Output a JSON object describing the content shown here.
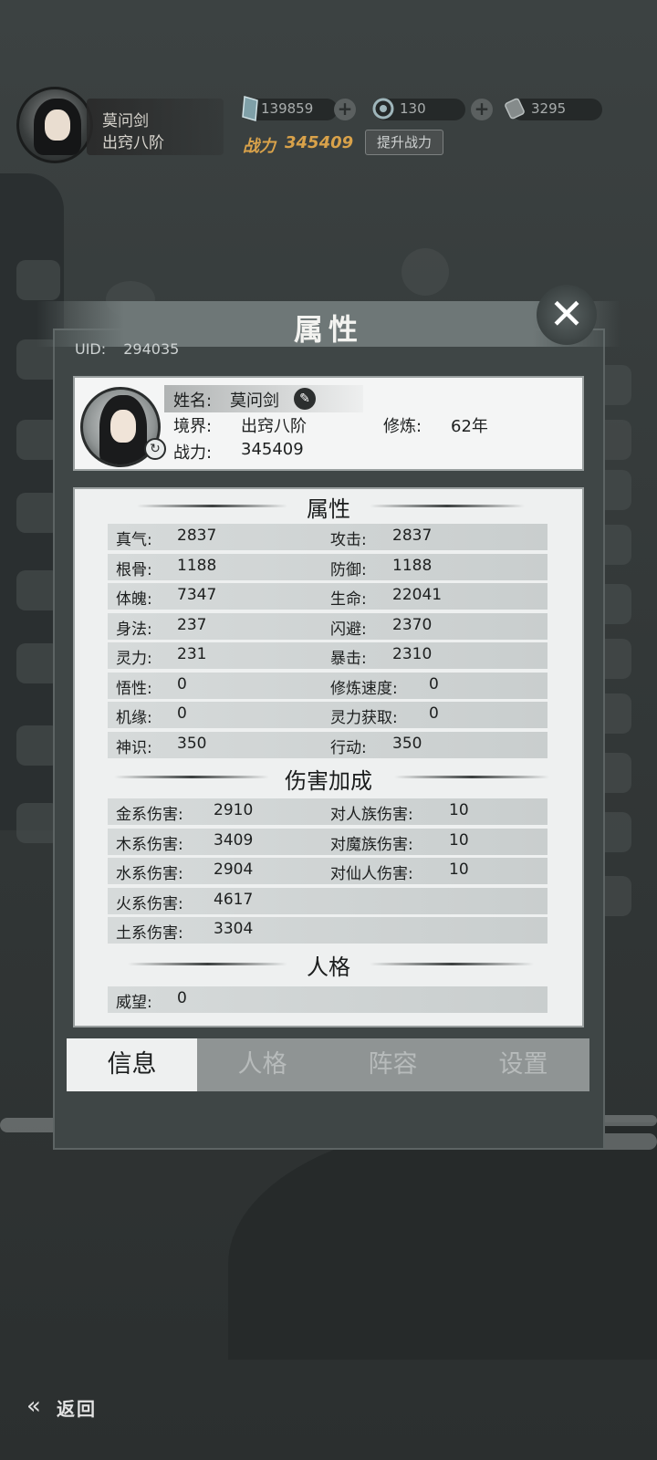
{
  "hud": {
    "player_name": "莫问剑",
    "player_realm": "出窍八阶",
    "spirit_stones": "139859",
    "jade": "130",
    "scrolls": "3295",
    "power_label": "战力",
    "power_value": "345409",
    "boost_label": "提升战力"
  },
  "dialog": {
    "title": "属性",
    "uid_label": "UID:",
    "uid_value": "294035",
    "profile": {
      "name_label": "姓名:",
      "name_value": "莫问剑",
      "realm_label": "境界:",
      "realm_value": "出窍八阶",
      "cultivation_label": "修炼:",
      "cultivation_value": "62年",
      "power_label": "战力:",
      "power_value": "345409"
    },
    "sections": {
      "attributes_title": "属性",
      "damage_title": "伤害加成",
      "personality_title": "人格"
    },
    "attributes": [
      {
        "l_label": "真气:",
        "l_value": "2837",
        "r_label": "攻击:",
        "r_value": "2837"
      },
      {
        "l_label": "根骨:",
        "l_value": "1188",
        "r_label": "防御:",
        "r_value": "1188"
      },
      {
        "l_label": "体魄:",
        "l_value": "7347",
        "r_label": "生命:",
        "r_value": "22041"
      },
      {
        "l_label": "身法:",
        "l_value": "237",
        "r_label": "闪避:",
        "r_value": "2370"
      },
      {
        "l_label": "灵力:",
        "l_value": "231",
        "r_label": "暴击:",
        "r_value": "2310"
      },
      {
        "l_label": "悟性:",
        "l_value": "0",
        "r_label": "修炼速度:",
        "r_value": "0"
      },
      {
        "l_label": "机缘:",
        "l_value": "0",
        "r_label": "灵力获取:",
        "r_value": "0"
      },
      {
        "l_label": "神识:",
        "l_value": "350",
        "r_label": "行动:",
        "r_value": "350"
      }
    ],
    "damage": [
      {
        "l_label": "金系伤害:",
        "l_value": "2910",
        "r_label": "对人族伤害:",
        "r_value": "10"
      },
      {
        "l_label": "木系伤害:",
        "l_value": "3409",
        "r_label": "对魔族伤害:",
        "r_value": "10"
      },
      {
        "l_label": "水系伤害:",
        "l_value": "2904",
        "r_label": "对仙人伤害:",
        "r_value": "10"
      },
      {
        "l_label": "火系伤害:",
        "l_value": "4617",
        "r_label": "",
        "r_value": ""
      },
      {
        "l_label": "土系伤害:",
        "l_value": "3304",
        "r_label": "",
        "r_value": ""
      }
    ],
    "personality": [
      {
        "label": "威望:",
        "value": "0"
      }
    ],
    "tabs": [
      "信息",
      "人格",
      "阵容",
      "设置"
    ],
    "active_tab": "信息"
  },
  "footer": {
    "back_label": "返回"
  },
  "colors": {
    "background": "#333838",
    "gold_power": "#d9a24a",
    "sheet": "#eef0f0"
  }
}
